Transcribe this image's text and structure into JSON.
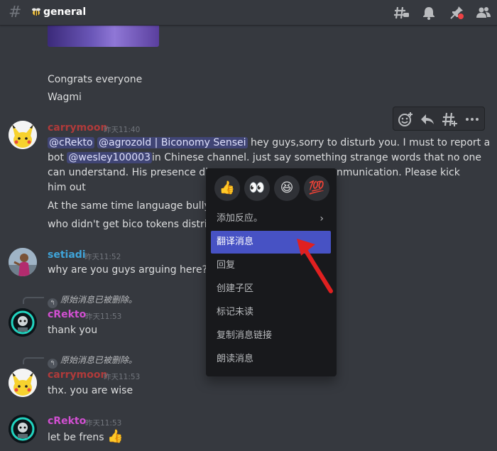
{
  "header": {
    "channel": "general",
    "icons": [
      "threads-icon",
      "bell-icon",
      "pin-icon",
      "members-icon"
    ]
  },
  "messages": {
    "congrats": "Congrats everyone",
    "wagmi": "Wagmi",
    "m1": {
      "author": "carrymoon",
      "author_color": "#b03a3a",
      "time": "昨天11:40",
      "mention1": "@cRekto",
      "mention2": "@agrozold | Biconomy Sensei",
      "line1_rest": "hey guys,sorry to disturb you. I must to report a",
      "line2_pre": "bot",
      "mention3": "@wesley100003",
      "line2_rest": "in Chinese channel. just say something strange words that no one",
      "line3_left": "can understand. His presence distu",
      "line3_right": "nmunication. Please kick",
      "line4": "him out",
      "line5": "At the same time language bullyin",
      "line6": "who didn't get bico tokens distribu"
    },
    "m2": {
      "author": "setiadi",
      "author_color": "#3fa4d9",
      "time": "昨天11:52",
      "text": "why are you guys arguing here?"
    },
    "m3": {
      "reply": "原始消息已被删除。",
      "author": "cRekto",
      "author_color": "#d14fd1",
      "time": "昨天11:53",
      "text": "thank you"
    },
    "m4": {
      "reply": "原始消息已被删除。",
      "author": "carrymoon",
      "author_color": "#b03a3a",
      "time": "昨天11:53",
      "text": "thx. you are wise"
    },
    "m5": {
      "author": "cRekto",
      "author_color": "#d14fd1",
      "time": "昨天11:53",
      "text": "let be frens",
      "emoji": "👍"
    }
  },
  "context_menu": {
    "reactions": [
      "👍",
      "👀",
      "😆",
      "💯"
    ],
    "items": [
      "添加反应。",
      "翻译消息",
      "回复",
      "创建子区",
      "标记未读",
      "复制消息链接",
      "朗读消息"
    ],
    "active_item": "翻译消息",
    "submenu_chevron": "›"
  },
  "colors": {
    "accent": "#4752c4",
    "annotation_arrow": "#e02020"
  }
}
